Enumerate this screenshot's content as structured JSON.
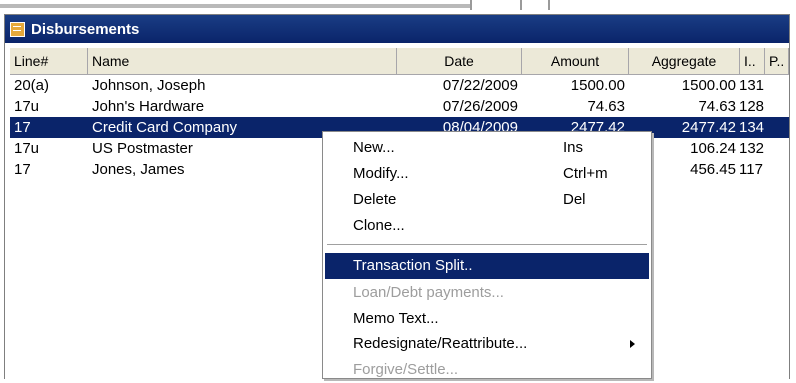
{
  "window": {
    "title": "Disbursements"
  },
  "columns": [
    "Line#",
    "Name",
    "Date",
    "Amount",
    "Aggregate",
    "I..",
    "P.."
  ],
  "rows": [
    {
      "line": "20(a)",
      "name": "Johnson, Joseph",
      "date": "07/22/2009",
      "amount": "1500.00",
      "aggregate": "1500.00",
      "i": "131",
      "p": "",
      "selected": false
    },
    {
      "line": "17u",
      "name": "John's Hardware",
      "date": "07/26/2009",
      "amount": "74.63",
      "aggregate": "74.63",
      "i": "128",
      "p": "",
      "selected": false
    },
    {
      "line": "17",
      "name": "Credit Card Company",
      "date": "08/04/2009",
      "amount": "2477.42",
      "aggregate": "2477.42",
      "i": "134",
      "p": "",
      "selected": true
    },
    {
      "line": "17u",
      "name": "US Postmaster",
      "date": "",
      "amount": "",
      "aggregate": "106.24",
      "i": "132",
      "p": "",
      "selected": false
    },
    {
      "line": "17",
      "name": "Jones, James",
      "date": "",
      "amount": "",
      "aggregate": "456.45",
      "i": "117",
      "p": "",
      "selected": false
    }
  ],
  "context_menu": {
    "items": [
      {
        "label": "New...",
        "shortcut": "Ins",
        "disabled": false
      },
      {
        "label": "Modify...",
        "shortcut": "Ctrl+m",
        "disabled": false
      },
      {
        "label": "Delete",
        "shortcut": "Del",
        "disabled": false
      },
      {
        "label": "Clone...",
        "shortcut": "",
        "disabled": false
      },
      {
        "label": "Transaction Split..",
        "shortcut": "",
        "disabled": false,
        "highlighted": true
      },
      {
        "label": "Loan/Debt payments...",
        "shortcut": "",
        "disabled": true
      },
      {
        "label": "Memo Text...",
        "shortcut": "",
        "disabled": false
      },
      {
        "label": "Redesignate/Reattribute...",
        "shortcut": "",
        "disabled": false,
        "submenu": true
      },
      {
        "label": "Forgive/Settle...",
        "shortcut": "",
        "disabled": true
      }
    ]
  },
  "colors": {
    "titlebar": "#0a246a",
    "selection": "#0a246a",
    "header_bg": "#ece9d8",
    "disabled_text": "#9d9d9d"
  }
}
